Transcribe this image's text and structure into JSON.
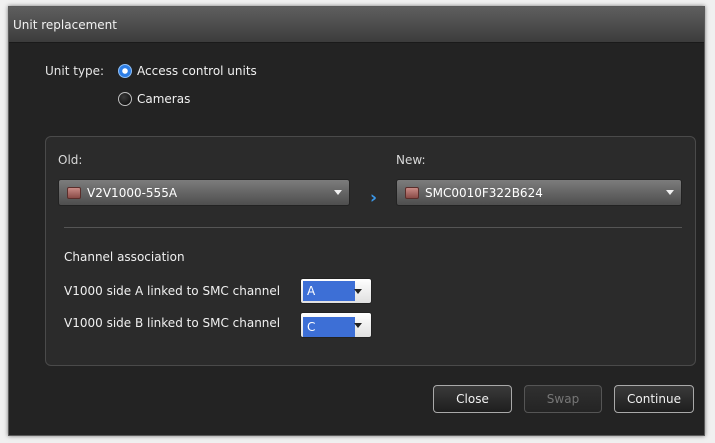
{
  "window": {
    "title": "Unit replacement"
  },
  "unit_type": {
    "label": "Unit type:",
    "options": [
      {
        "label": "Access control units",
        "checked": true
      },
      {
        "label": "Cameras",
        "checked": false
      }
    ]
  },
  "old": {
    "label": "Old:",
    "value": "V2V1000-555A"
  },
  "new": {
    "label": "New:",
    "value": "SMC0010F322B624"
  },
  "channel_association": {
    "heading": "Channel association",
    "rows": [
      {
        "label": "V1000 side A linked to SMC channel",
        "value": "A"
      },
      {
        "label": "V1000 side B linked to SMC channel",
        "value": "C"
      }
    ]
  },
  "buttons": {
    "close": "Close",
    "swap": "Swap",
    "continue": "Continue"
  },
  "colors": {
    "accent": "#2d7ee6",
    "background": "#232323"
  }
}
